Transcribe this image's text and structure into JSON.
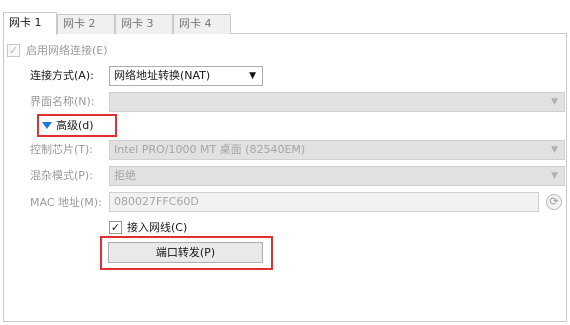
{
  "tabs": [
    {
      "label": "网卡 1"
    },
    {
      "label": "网卡 2"
    },
    {
      "label": "网卡 3"
    },
    {
      "label": "网卡 4"
    }
  ],
  "adapter": {
    "enable_label": "启用网络连接(E)",
    "enable_checked": true,
    "attached_label": "连接方式(A):",
    "attached_value": "网络地址转换(NAT)",
    "name_label": "界面名称(N):",
    "name_value": ""
  },
  "advanced": {
    "toggle_label": "高级(d)",
    "chip_label": "控制芯片(T):",
    "chip_value": "Intel PRO/1000 MT 桌面 (82540EM)",
    "promisc_label": "混杂模式(P):",
    "promisc_value": "拒绝",
    "mac_label": "MAC 地址(M):",
    "mac_value": "080027FFC60D",
    "cable_label": "接入网线(C)",
    "cable_checked": true,
    "port_forward_label": "端口转发(P)"
  },
  "glyphs": {
    "check": "✓",
    "dropdown": "▼",
    "refresh": "⟳"
  },
  "colors": {
    "highlight_box": "#e03030",
    "expand_triangle": "#1e78d7"
  }
}
